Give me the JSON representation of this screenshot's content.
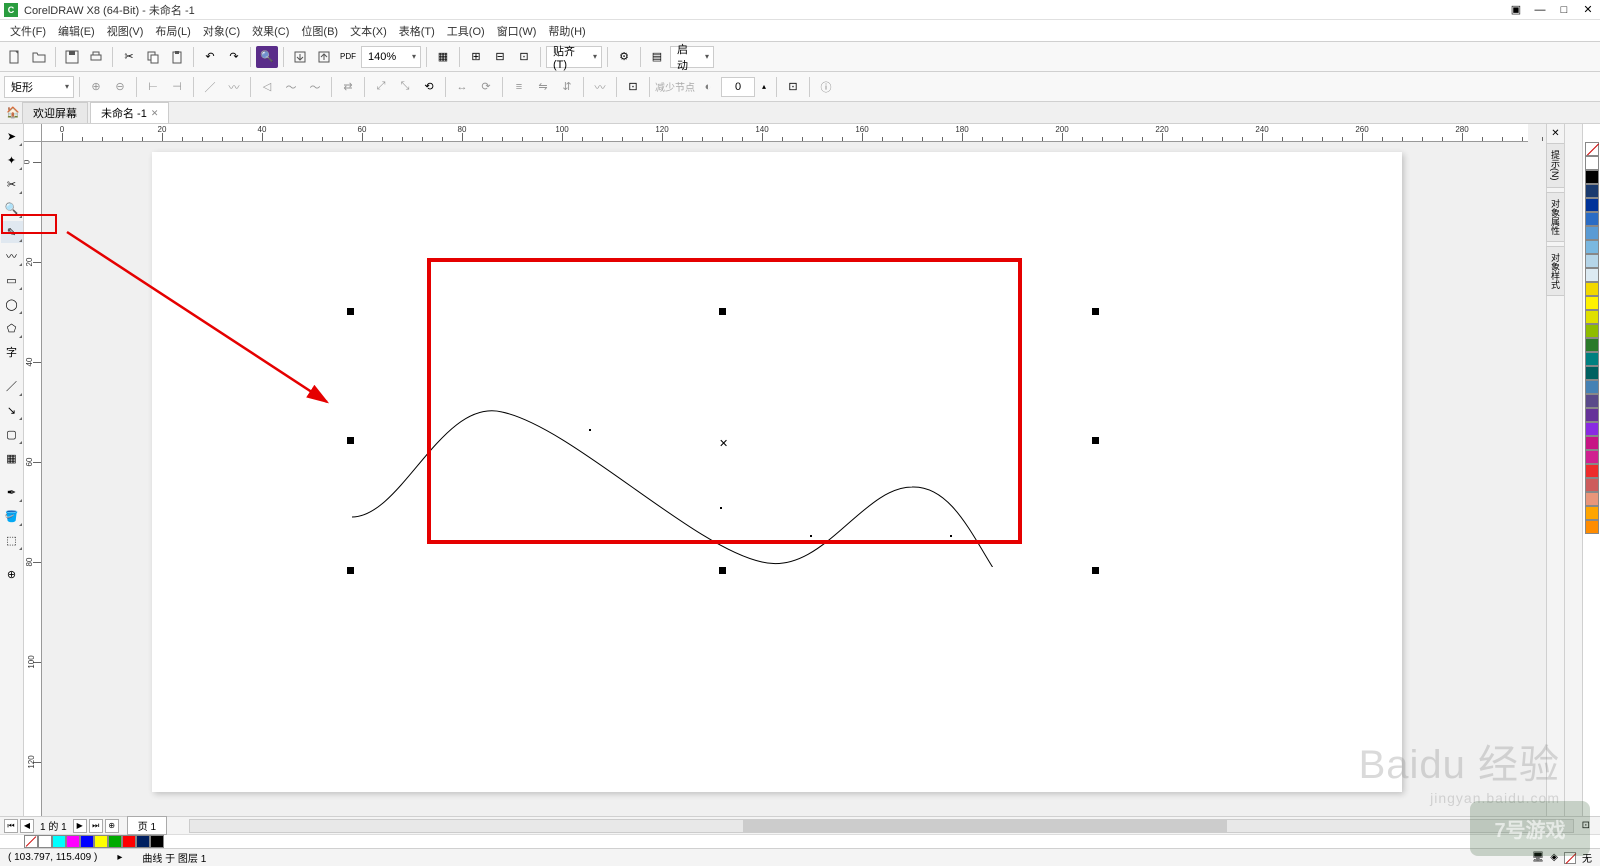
{
  "title": "CorelDRAW X8 (64-Bit) - 未命名 -1",
  "menu": [
    "文件(F)",
    "编辑(E)",
    "视图(V)",
    "布局(L)",
    "对象(C)",
    "效果(C)",
    "位图(B)",
    "文本(X)",
    "表格(T)",
    "工具(O)",
    "窗口(W)",
    "帮助(H)"
  ],
  "toolbar": {
    "zoom": "140%",
    "snap_label": "贴齐(T)",
    "launch_label": "启动"
  },
  "property": {
    "shape": "矩形",
    "reduce_label": "减少节点",
    "value": "0"
  },
  "tabs": {
    "welcome": "欢迎屏幕",
    "doc": "未命名 -1"
  },
  "dockers": [
    "提示(N)",
    "对象属性",
    "对象样式"
  ],
  "ruler_h": [
    0,
    20,
    40,
    60,
    80,
    100,
    120,
    140,
    160,
    180,
    200,
    220,
    240,
    260,
    280
  ],
  "ruler_v": [
    0,
    20,
    40,
    60,
    80,
    100,
    120
  ],
  "palette_right": [
    "#ffffff",
    "#000000",
    "#1a3a6e",
    "#003399",
    "#2b6cc4",
    "#5a9bd4",
    "#7ab8e0",
    "#b5d5e8",
    "#dceaf2",
    "#f2d800",
    "#fff200",
    "#e0e000",
    "#8fbc00",
    "#2a7a2a",
    "#008080",
    "#006060",
    "#4682b4",
    "#5a4a8a",
    "#663399",
    "#8a2be2",
    "#c71585",
    "#d02090",
    "#ee2c2c",
    "#cd5c5c",
    "#e9967a",
    "#ffa500",
    "#ff8c00"
  ],
  "palette_bottom": [
    "#ffffff",
    "#00ffff",
    "#ff00ff",
    "#0000ff",
    "#ffff00",
    "#00aa00",
    "#ff0000",
    "#002060",
    "#000000"
  ],
  "page_nav": {
    "counter": "1 的 1",
    "page_tab": "页 1"
  },
  "status": {
    "coords": "( 103.797, 115.409 )",
    "arrow": "▸",
    "object": "曲线 于 图层 1",
    "fill_none": "无"
  },
  "watermark": {
    "brand": "Baidu 经验",
    "url": "jingyan.baidu.com"
  },
  "game_logo": "7号游戏"
}
